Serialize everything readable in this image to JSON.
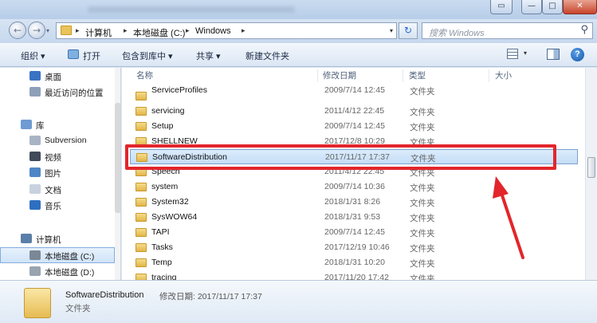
{
  "window": {
    "min_glyph": "—",
    "max_glyph": "□",
    "close_glyph": "✕",
    "help_glyph": "▭"
  },
  "address": {
    "crumbs": [
      "计算机",
      "本地磁盘 (C:)",
      "Windows"
    ],
    "separator": "▸",
    "search_placeholder": "搜索 Windows"
  },
  "toolbar": {
    "organize": "组织 ▾",
    "open": "打开",
    "include_in_library": "包含到库中 ▾",
    "share": "共享 ▾",
    "new_folder": "新建文件夹",
    "help": "?"
  },
  "nav": {
    "items": [
      {
        "label": "桌面",
        "icon": "desktop-icon",
        "color": "#3a72c4"
      },
      {
        "label": "最近访问的位置",
        "icon": "recent-places-icon",
        "color": "#8da0b8"
      },
      {
        "label": "库",
        "icon": "libraries-icon",
        "color": "#6d9bd2"
      },
      {
        "label": "Subversion",
        "icon": "library-folder-icon",
        "color": "#a8b4c4"
      },
      {
        "label": "视频",
        "icon": "video-library-icon",
        "color": "#404a58"
      },
      {
        "label": "图片",
        "icon": "pictures-library-icon",
        "color": "#4f86c6"
      },
      {
        "label": "文档",
        "icon": "documents-library-icon",
        "color": "#c8d2de"
      },
      {
        "label": "音乐",
        "icon": "music-library-icon",
        "color": "#2f6fc0"
      },
      {
        "label": "计算机",
        "icon": "computer-icon",
        "color": "#5b7ea8"
      },
      {
        "label": "本地磁盘 (C:)",
        "icon": "drive-c-icon",
        "color": "#7c8796"
      },
      {
        "label": "本地磁盘 (D:)",
        "icon": "drive-d-icon",
        "color": "#9aa4b1"
      }
    ]
  },
  "list": {
    "columns": [
      "名称",
      "修改日期",
      "类型",
      "大小"
    ],
    "rows": [
      {
        "name": "ServiceProfiles",
        "date": "2009/7/14 12:45",
        "type": "文件夹"
      },
      {
        "name": "servicing",
        "date": "2011/4/12 22:45",
        "type": "文件夹"
      },
      {
        "name": "Setup",
        "date": "2009/7/14 12:45",
        "type": "文件夹"
      },
      {
        "name": "SHELLNEW",
        "date": "2017/12/8 10:29",
        "type": "文件夹"
      },
      {
        "name": "SoftwareDistribution",
        "date": "2017/11/17 17:37",
        "type": "文件夹"
      },
      {
        "name": "Speech",
        "date": "2011/4/12 22:45",
        "type": "文件夹"
      },
      {
        "name": "system",
        "date": "2009/7/14 10:36",
        "type": "文件夹"
      },
      {
        "name": "System32",
        "date": "2018/1/31 8:26",
        "type": "文件夹"
      },
      {
        "name": "SysWOW64",
        "date": "2018/1/31 9:53",
        "type": "文件夹"
      },
      {
        "name": "TAPI",
        "date": "2009/7/14 12:45",
        "type": "文件夹"
      },
      {
        "name": "Tasks",
        "date": "2017/12/19 10:46",
        "type": "文件夹"
      },
      {
        "name": "Temp",
        "date": "2018/1/31 10:20",
        "type": "文件夹"
      },
      {
        "name": "tracing",
        "date": "2017/11/20 17:42",
        "type": "文件夹"
      }
    ]
  },
  "details": {
    "name": "SoftwareDistribution",
    "meta": "修改日期: 2017/11/17 17:37",
    "type": "文件夹"
  },
  "colors": {
    "highlight": "#e2262b",
    "selection": "#c4ddf6"
  }
}
